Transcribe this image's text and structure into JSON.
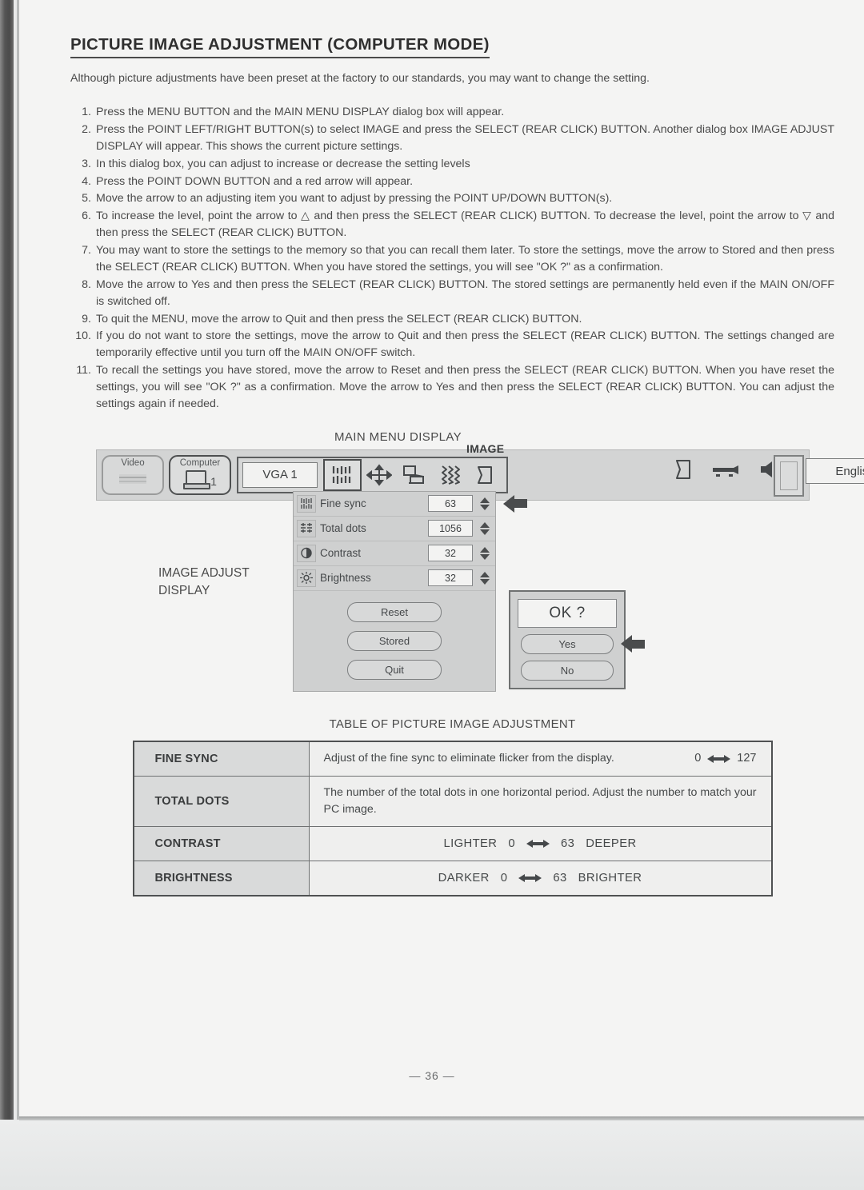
{
  "page": {
    "title": "PICTURE IMAGE ADJUSTMENT (COMPUTER MODE)",
    "intro": "Although picture adjustments have been preset at the factory to our standards, you may want to change the setting.",
    "page_number": "— 36 —"
  },
  "steps": [
    {
      "num": "1.",
      "text": "Press the MENU BUTTON and the MAIN MENU DISPLAY dialog box will appear."
    },
    {
      "num": "2.",
      "text": "Press the POINT LEFT/RIGHT BUTTON(s) to select IMAGE and press the SELECT (REAR CLICK) BUTTON. Another dialog box IMAGE ADJUST DISPLAY will appear. This shows the current picture settings."
    },
    {
      "num": "3.",
      "text": "In this dialog box, you can adjust to increase or decrease the setting levels"
    },
    {
      "num": "4.",
      "text": "Press the POINT DOWN BUTTON and a red arrow will appear."
    },
    {
      "num": "5.",
      "text": "Move the arrow to an adjusting item you want to adjust by pressing the POINT UP/DOWN BUTTON(s)."
    },
    {
      "num": "6.",
      "text": "To increase the level, point the arrow to △ and then press the SELECT (REAR CLICK) BUTTON. To decrease the level, point the arrow to ▽ and then press the SELECT (REAR CLICK) BUTTON."
    },
    {
      "num": "7.",
      "text": "You may want to store the settings to the memory so that you can recall them later. To store the settings, move the arrow to Stored and then press the SELECT (REAR CLICK) BUTTON. When you have stored the settings, you will see \"OK ?\" as a confirmation."
    },
    {
      "num": "8.",
      "text": "Move the arrow to Yes and then press the SELECT (REAR CLICK) BUTTON. The stored settings are permanently held even if the MAIN ON/OFF is switched off."
    },
    {
      "num": "9.",
      "text": "To quit the MENU, move the arrow to Quit and then press the SELECT (REAR CLICK) BUTTON."
    },
    {
      "num": "10.",
      "text": "If you do not want to store the settings, move the arrow to Quit and then press the SELECT (REAR CLICK) BUTTON. The settings changed are temporarily effective until you turn off the MAIN ON/OFF switch."
    },
    {
      "num": "11.",
      "text": "To recall the settings you have stored, move the arrow to Reset and then press the SELECT (REAR CLICK) BUTTON. When you have reset the settings, you will see \"OK ?\" as a confirmation. Move the arrow to Yes and then press the SELECT (REAR CLICK) BUTTON. You can adjust the settings again if needed."
    }
  ],
  "diagram": {
    "main_menu_caption": "MAIN MENU DISPLAY",
    "adjust_display_label": "IMAGE ADJUST\nDISPLAY",
    "menubar": {
      "video_label": "Video",
      "computer_label": "Computer",
      "computer_number": "1",
      "image_group_label": "IMAGE",
      "source_value": "VGA 1",
      "language_value": "English",
      "image_icons": [
        "fine-sync-icon",
        "position-arrows-icon",
        "pc-screen-icon",
        "wave-pattern-icon",
        "keystone-icon"
      ],
      "right_icons": [
        "keystone-icon",
        "projector-icon",
        "volume-icon"
      ]
    },
    "adjust_dialog": {
      "rows": [
        {
          "icon": "fine-sync-icon",
          "label": "Fine sync",
          "value": "63",
          "has_pointer": true
        },
        {
          "icon": "total-dots-icon",
          "label": "Total dots",
          "value": "1056",
          "has_pointer": false
        },
        {
          "icon": "contrast-icon",
          "label": "Contrast",
          "value": "32",
          "has_pointer": false
        },
        {
          "icon": "brightness-icon",
          "label": "Brightness",
          "value": "32",
          "has_pointer": false
        }
      ],
      "buttons": [
        "Reset",
        "Stored",
        "Quit"
      ]
    },
    "ok_panel": {
      "prompt": "OK ?",
      "yes_label": "Yes",
      "no_label": "No"
    }
  },
  "table": {
    "caption": "TABLE OF PICTURE IMAGE ADJUSTMENT",
    "rows": [
      {
        "key": "FINE SYNC",
        "kind": "desc-range",
        "desc": "Adjust of the fine sync to eliminate flicker from the display.",
        "range_min": "0",
        "range_max": "127"
      },
      {
        "key": "TOTAL DOTS",
        "kind": "desc",
        "desc": "The number of the total dots in one horizontal period. Adjust the number to match your PC image."
      },
      {
        "key": "CONTRAST",
        "kind": "scale",
        "left_label": "LIGHTER",
        "range_min": "0",
        "range_max": "63",
        "right_label": "DEEPER"
      },
      {
        "key": "BRIGHTNESS",
        "kind": "scale",
        "left_label": "DARKER",
        "range_min": "0",
        "range_max": "63",
        "right_label": "BRIGHTER"
      }
    ]
  }
}
